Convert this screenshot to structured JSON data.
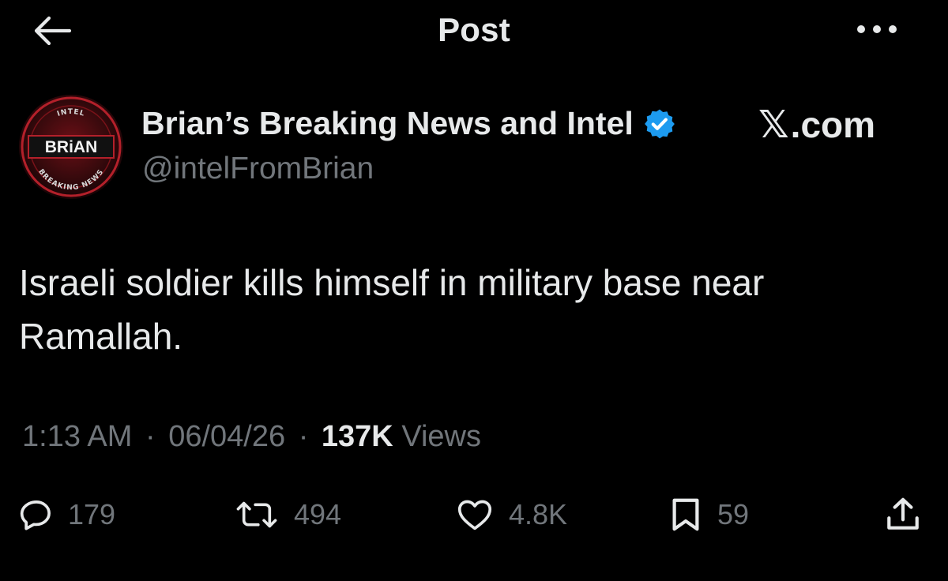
{
  "header": {
    "title": "Post",
    "back_icon": "arrow-left-icon",
    "more_icon": "ellipsis-icon"
  },
  "author": {
    "display_name": "Brian’s Breaking News and Intel",
    "handle": "@intelFromBrian",
    "verified": true,
    "avatar_text": "BRiAN",
    "avatar_ring_top": "INTEL",
    "avatar_ring_bottom": "BREAKING NEWS",
    "verified_color": "#1d9bf0"
  },
  "watermark": {
    "x": "𝕏",
    "domain": ".com"
  },
  "post": {
    "text": "Israeli soldier kills himself in military base near Ramallah."
  },
  "meta": {
    "time": "1:13 AM",
    "date": "06/04/26",
    "views_count": "137K",
    "views_label": "Views",
    "separator": "·"
  },
  "actions": {
    "replies": "179",
    "reposts": "494",
    "likes": "4.8K",
    "bookmarks": "59"
  },
  "colors": {
    "background": "#000000",
    "primary_text": "#e7e9ea",
    "secondary_text": "#71767b",
    "avatar_red": "#b3202a"
  }
}
